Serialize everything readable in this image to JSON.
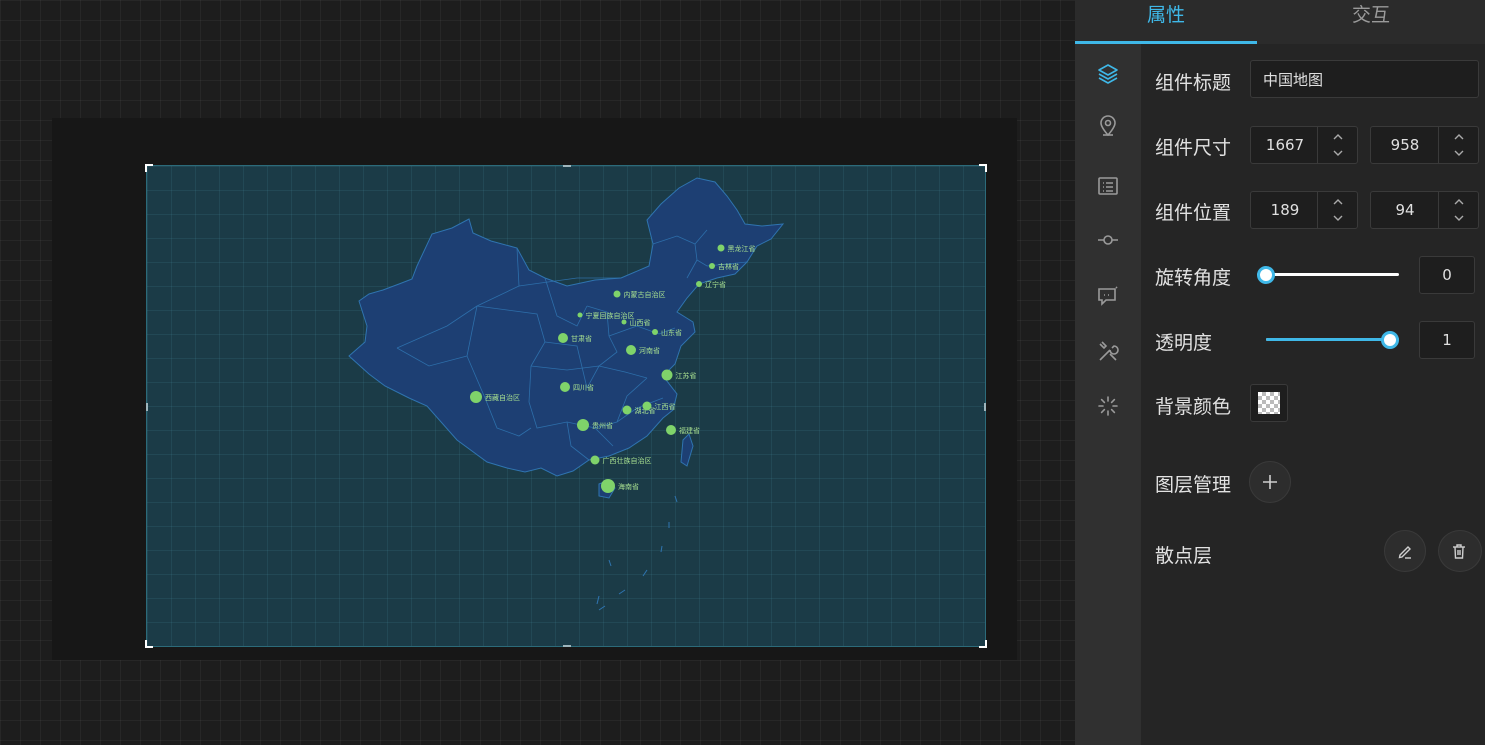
{
  "tabs": [
    {
      "label": "属性",
      "active": true
    },
    {
      "label": "交互",
      "active": false
    }
  ],
  "side_icons": [
    "layers-icon",
    "map-pin-icon",
    "list-icon",
    "connector-icon",
    "chat-icon",
    "tools-icon",
    "loading-icon"
  ],
  "properties": {
    "title_label": "组件标题",
    "title_value": "中国地图",
    "size_label": "组件尺寸",
    "width": "1667",
    "height": "958",
    "position_label": "组件位置",
    "pos_x": "189",
    "pos_y": "94",
    "rotation_label": "旋转角度",
    "rotation_value": "0",
    "rotation_fraction": 0,
    "opacity_label": "透明度",
    "opacity_value": "1",
    "opacity_fraction": 1,
    "bg_color_label": "背景颜色",
    "layer_manage_label": "图层管理",
    "layer_name": "散点层"
  },
  "map": {
    "points": [
      {
        "label": "黑龙江省"
      },
      {
        "label": "吉林省"
      },
      {
        "label": "辽宁省"
      },
      {
        "label": "内蒙古自治区"
      },
      {
        "label": "宁夏回族自治区"
      },
      {
        "label": "山西省"
      },
      {
        "label": "山东省"
      },
      {
        "label": "甘肃省"
      },
      {
        "label": "河南省"
      },
      {
        "label": "江苏省"
      },
      {
        "label": "西藏自治区"
      },
      {
        "label": "四川省"
      },
      {
        "label": "湖北省"
      },
      {
        "label": "江西省"
      },
      {
        "label": "贵州省"
      },
      {
        "label": "福建省"
      },
      {
        "label": "广西壮族自治区"
      },
      {
        "label": "海南省"
      }
    ]
  },
  "colors": {
    "accent": "#3fb8e8",
    "map_fill": "#1d3f73",
    "map_border": "#2f74b0",
    "point": "#7fd36a",
    "canvas_bg": "#1b3b47"
  }
}
